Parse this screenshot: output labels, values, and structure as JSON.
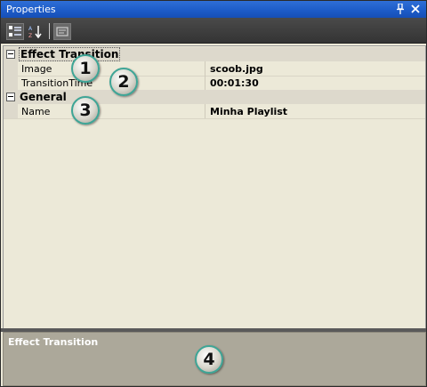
{
  "window": {
    "title": "Properties"
  },
  "titlebar_buttons": {
    "pin_icon": "pin-icon",
    "close_icon": "close-icon"
  },
  "toolbar": {
    "categorized_icon": "categorized-icon",
    "alphabetical_icon": "alphabetical-icon",
    "property_pages_icon": "property-pages-icon"
  },
  "categories": [
    {
      "label": "Effect Transition",
      "properties": [
        {
          "name": "Image",
          "value": "scoob.jpg"
        },
        {
          "name": "TransitionTime",
          "value": "00:01:30"
        }
      ]
    },
    {
      "label": "General",
      "properties": [
        {
          "name": "Name",
          "value": "Minha Playlist"
        }
      ]
    }
  ],
  "description": {
    "title": "Effect Transition"
  },
  "callouts": [
    "1",
    "2",
    "3",
    "4"
  ],
  "colors": {
    "titlebar": "#1d5cc9",
    "callout_border": "#3ea596"
  }
}
